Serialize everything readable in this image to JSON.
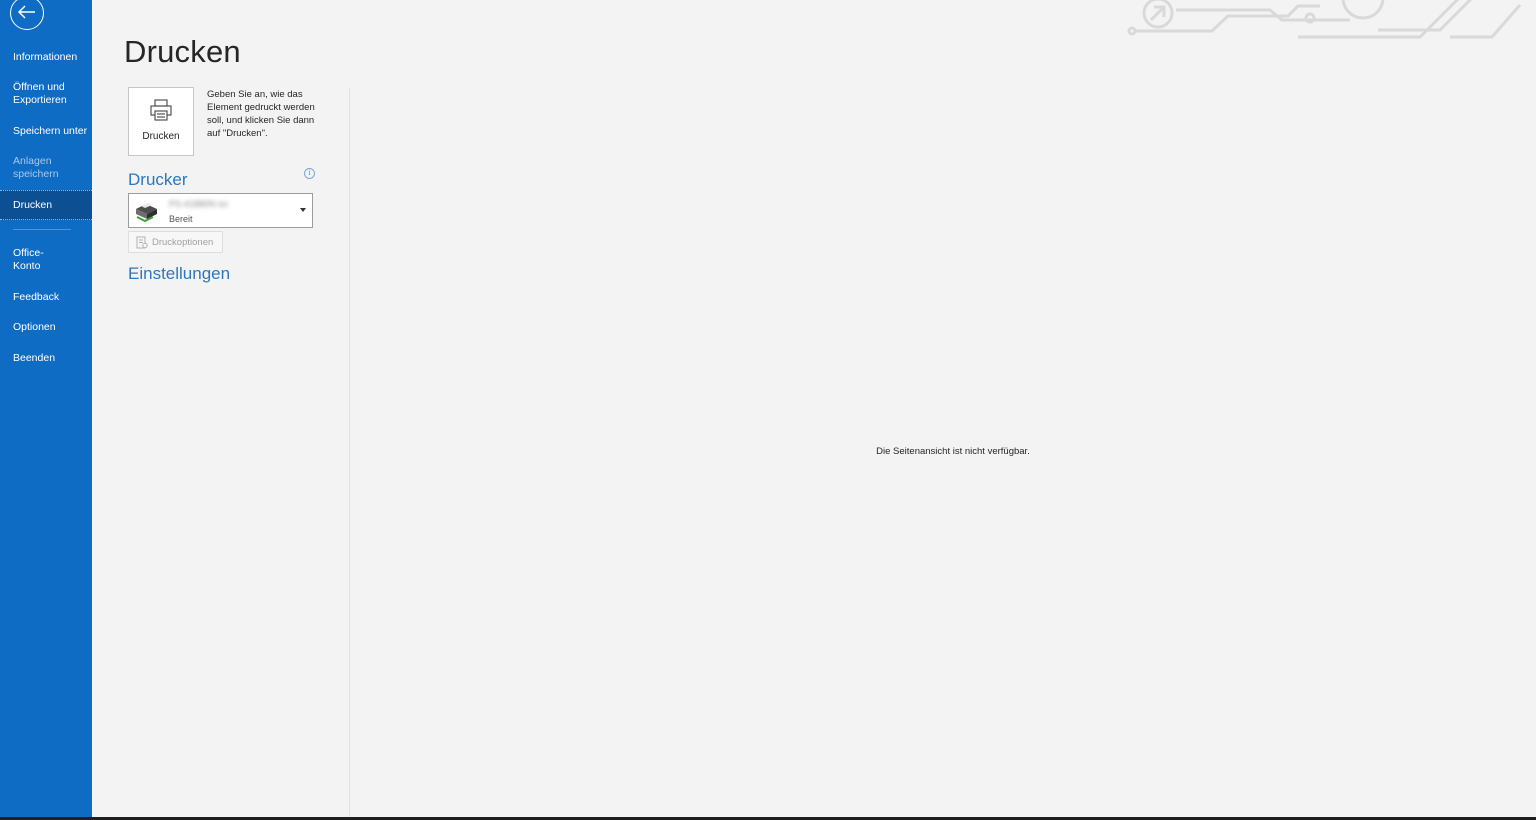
{
  "sidebar": {
    "back_icon": "arrow-left-circle-icon",
    "items": [
      {
        "label": "Informationen",
        "state": "normal"
      },
      {
        "label": "Öffnen und Exportieren",
        "state": "normal"
      },
      {
        "label": "Speichern unter",
        "state": "normal"
      },
      {
        "label": "Anlagen speichern",
        "state": "disabled"
      },
      {
        "label": "Drucken",
        "state": "active"
      },
      {
        "label": "Office-Konto",
        "state": "normal"
      },
      {
        "label": "Feedback",
        "state": "normal"
      },
      {
        "label": "Optionen",
        "state": "normal"
      },
      {
        "label": "Beenden",
        "state": "normal"
      }
    ]
  },
  "page": {
    "title": "Drucken"
  },
  "print_action": {
    "button_label": "Drucken",
    "icon": "printer-icon",
    "description": "Geben Sie an, wie das Element gedruckt werden soll, und klicken Sie dann auf \"Drucken\"."
  },
  "printer": {
    "heading": "Drucker",
    "info_icon": "info-icon",
    "selected_name": "PS-41880N on",
    "status": "Bereit",
    "options_label": "Druckoptionen"
  },
  "settings": {
    "heading": "Einstellungen"
  },
  "preview": {
    "message": "Die Seitenansicht ist nicht verfügbar."
  },
  "colors": {
    "sidebar_bg": "#0f6cc4",
    "sidebar_active": "#0c4f93",
    "accent_heading": "#2b78be",
    "page_bg": "#f3f3f3"
  }
}
